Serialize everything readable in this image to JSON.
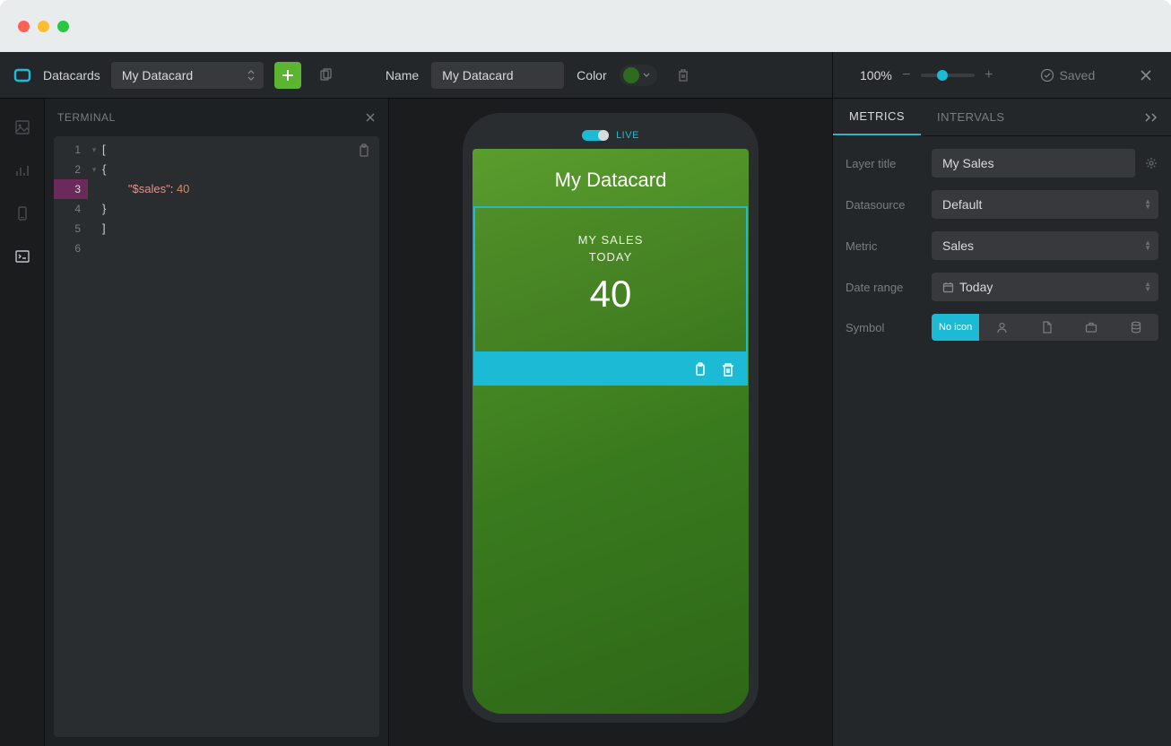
{
  "toolbar": {
    "datacards_label": "Datacards",
    "datacard_selected": "My Datacard",
    "name_label": "Name",
    "name_value": "My Datacard",
    "color_label": "Color",
    "card_color": "#2e6b1f",
    "zoom_pct": "100%",
    "saved_label": "Saved"
  },
  "terminal": {
    "header": "TERMINAL",
    "lines": [
      "1",
      "2",
      "3",
      "4",
      "5",
      "6"
    ],
    "code": {
      "l1": "[",
      "l2": "    {",
      "l3_key": "\"$sales\"",
      "l3_sep": ": ",
      "l3_val": "40",
      "l4": "    }",
      "l5": "]",
      "l6": ""
    }
  },
  "preview": {
    "live_label": "LIVE",
    "card_title": "My Datacard",
    "metric_label": "MY SALES",
    "metric_sub": "TODAY",
    "metric_value": "40"
  },
  "panel": {
    "tabs": {
      "metrics": "METRICS",
      "intervals": "INTERVALS"
    },
    "layer_title_label": "Layer title",
    "layer_title_value": "My Sales",
    "datasource_label": "Datasource",
    "datasource_value": "Default",
    "metric_label": "Metric",
    "metric_value": "Sales",
    "date_range_label": "Date range",
    "date_range_value": "Today",
    "symbol_label": "Symbol",
    "symbol_noicon": "No icon"
  }
}
